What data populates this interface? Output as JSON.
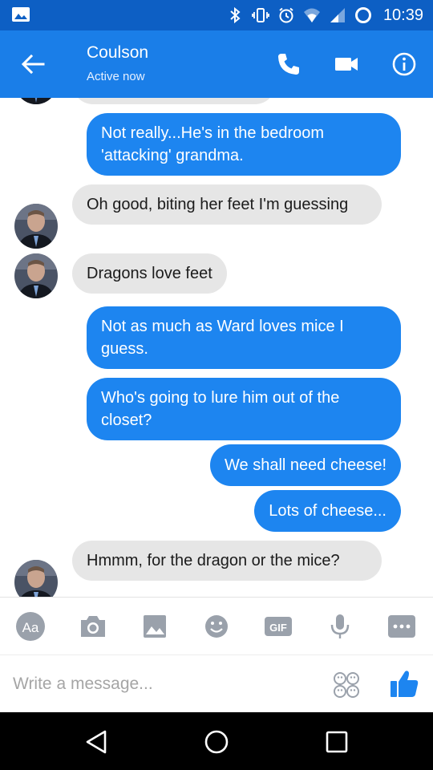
{
  "status_bar": {
    "time": "10:39",
    "icons": [
      "image-notification-icon",
      "bluetooth-icon",
      "vibrate-icon",
      "alarm-icon",
      "wifi-icon",
      "signal-icon",
      "battery-icon"
    ]
  },
  "header": {
    "name": "Coulson",
    "status": "Active now",
    "icons": [
      "back-arrow-icon",
      "phone-icon",
      "video-camera-icon",
      "info-icon"
    ]
  },
  "messages": [
    {
      "dir": "out",
      "text": "Not really...He's in the bedroom 'attacking' grandma."
    },
    {
      "dir": "in",
      "text": "Oh good, biting her feet I'm guessing"
    },
    {
      "dir": "in",
      "text": "Dragons love feet"
    },
    {
      "dir": "out",
      "text": "Not as much as Ward loves mice I guess."
    },
    {
      "dir": "out",
      "text": "Who's going to lure him out of the closet?"
    },
    {
      "dir": "out",
      "text": "We shall need cheese!"
    },
    {
      "dir": "out",
      "text": "Lots of cheese..."
    },
    {
      "dir": "in",
      "text": "Hmmm, for the dragon or the mice?"
    }
  ],
  "toolbar": {
    "text_format_label": "Aa",
    "gif_label": "GIF",
    "icons": [
      "text-format-icon",
      "camera-icon",
      "gallery-icon",
      "emoji-icon",
      "gif-icon",
      "microphone-icon",
      "more-icon"
    ]
  },
  "composer": {
    "placeholder": "Write a message..."
  },
  "colors": {
    "status_bar": "#0d5fc4",
    "header": "#1a7ee8",
    "outgoing_bubble": "#1d85f0",
    "incoming_bubble": "#e6e6e6"
  }
}
